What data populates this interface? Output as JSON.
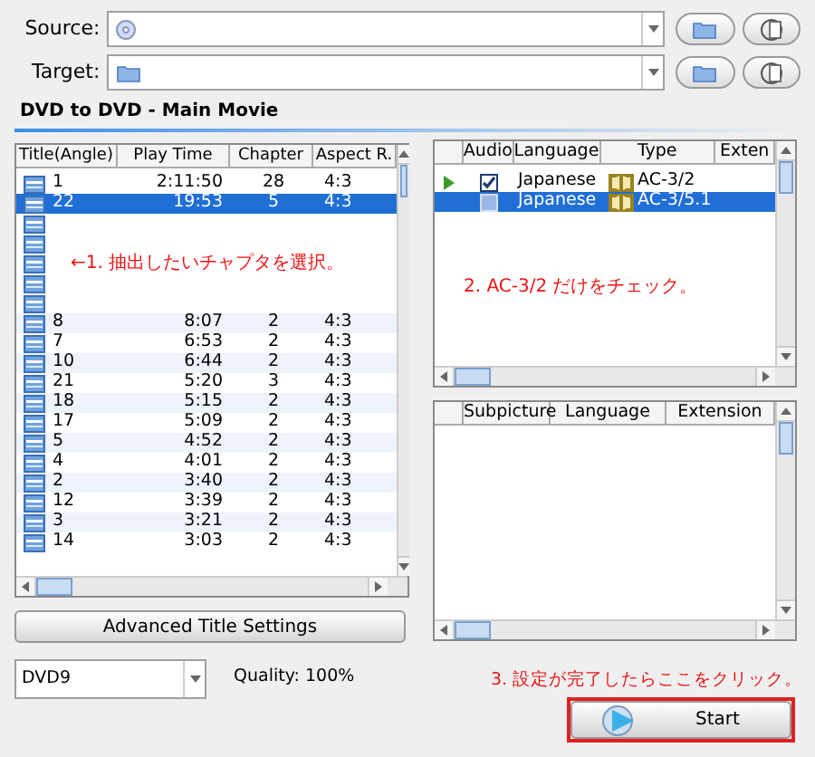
{
  "source": {
    "label": "Source:"
  },
  "target": {
    "label": "Target:"
  },
  "section_title": "DVD to DVD - Main Movie",
  "titles_table": {
    "columns": [
      "Title(Angle)",
      "Play Time",
      "Chapter",
      "Aspect R."
    ],
    "rows": [
      {
        "kind": "row",
        "selected": false,
        "cells": [
          "1",
          "2:11:50",
          "28",
          "4:3"
        ]
      },
      {
        "kind": "row",
        "selected": true,
        "cells": [
          "22",
          "19:53",
          "5",
          "4:3"
        ]
      },
      {
        "kind": "covered"
      },
      {
        "kind": "covered"
      },
      {
        "kind": "covered"
      },
      {
        "kind": "covered"
      },
      {
        "kind": "covered"
      },
      {
        "kind": "row",
        "selected": false,
        "cells": [
          "8",
          "8:07",
          "2",
          "4:3"
        ]
      },
      {
        "kind": "row",
        "selected": false,
        "cells": [
          "7",
          "6:53",
          "2",
          "4:3"
        ]
      },
      {
        "kind": "row",
        "selected": false,
        "cells": [
          "10",
          "6:44",
          "2",
          "4:3"
        ]
      },
      {
        "kind": "row",
        "selected": false,
        "cells": [
          "21",
          "5:20",
          "3",
          "4:3"
        ]
      },
      {
        "kind": "row",
        "selected": false,
        "cells": [
          "18",
          "5:15",
          "2",
          "4:3"
        ]
      },
      {
        "kind": "row",
        "selected": false,
        "cells": [
          "17",
          "5:09",
          "2",
          "4:3"
        ]
      },
      {
        "kind": "row",
        "selected": false,
        "cells": [
          "5",
          "4:52",
          "2",
          "4:3"
        ]
      },
      {
        "kind": "row",
        "selected": false,
        "cells": [
          "4",
          "4:01",
          "2",
          "4:3"
        ]
      },
      {
        "kind": "row",
        "selected": false,
        "cells": [
          "2",
          "3:40",
          "2",
          "4:3"
        ]
      },
      {
        "kind": "row",
        "selected": false,
        "cells": [
          "12",
          "3:39",
          "2",
          "4:3"
        ]
      },
      {
        "kind": "row",
        "selected": false,
        "cells": [
          "3",
          "3:21",
          "2",
          "4:3"
        ]
      },
      {
        "kind": "row",
        "selected": false,
        "cells": [
          "14",
          "3:03",
          "2",
          "4:3"
        ]
      }
    ],
    "note": "←1. 抽出したいチャプタを選択。"
  },
  "audio_table": {
    "columns": [
      "Audio",
      "Language",
      "Type",
      "Exten"
    ],
    "rows": [
      {
        "playing": true,
        "checked": true,
        "selected": false,
        "language": "Japanese",
        "type": "AC-3/2"
      },
      {
        "playing": false,
        "checked": false,
        "selected": true,
        "language": "Japanese",
        "type": "AC-3/5.1"
      }
    ],
    "note": "2. AC-3/2 だけをチェック。"
  },
  "subpicture_table": {
    "columns": [
      "Subpicture",
      "Language",
      "Extension"
    ]
  },
  "advanced_button": "Advanced Title Settings",
  "disc_type": {
    "value": "DVD9"
  },
  "quality": "Quality: 100%",
  "start_note": "3. 設定が完了したらここをクリック。",
  "start_button": "Start"
}
